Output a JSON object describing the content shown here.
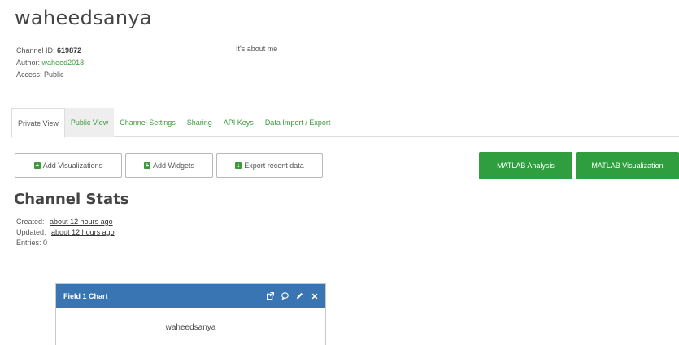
{
  "channel": {
    "title": "waheedsanya",
    "id_label": "Channel ID:",
    "id_value": "619872",
    "author_label": "Author:",
    "author_value": "waheed2018",
    "access_label": "Access:",
    "access_value": "Public",
    "description": "It's about me"
  },
  "tabs": [
    {
      "label": "Private View"
    },
    {
      "label": "Public View"
    },
    {
      "label": "Channel Settings"
    },
    {
      "label": "Sharing"
    },
    {
      "label": "API Keys"
    },
    {
      "label": "Data Import / Export"
    }
  ],
  "actions": {
    "add_visualizations": "Add Visualizations",
    "add_widgets": "Add Widgets",
    "export_recent": "Export recent data",
    "matlab_analysis": "MATLAB Analysis",
    "matlab_visualization": "MATLAB Visualization"
  },
  "stats": {
    "heading": "Channel Stats",
    "created_label": "Created:",
    "created_value": "about 12 hours ago",
    "updated_label": "Updated:",
    "updated_value": "about 12 hours ago",
    "entries_label": "Entries:",
    "entries_value": "0"
  },
  "chart_panel": {
    "title": "Field 1 Chart",
    "chart_title": "waheedsanya"
  },
  "colors": {
    "green": "#2e9e3e",
    "link_green": "#3c9a3c",
    "panel_blue": "#3a75b3"
  }
}
